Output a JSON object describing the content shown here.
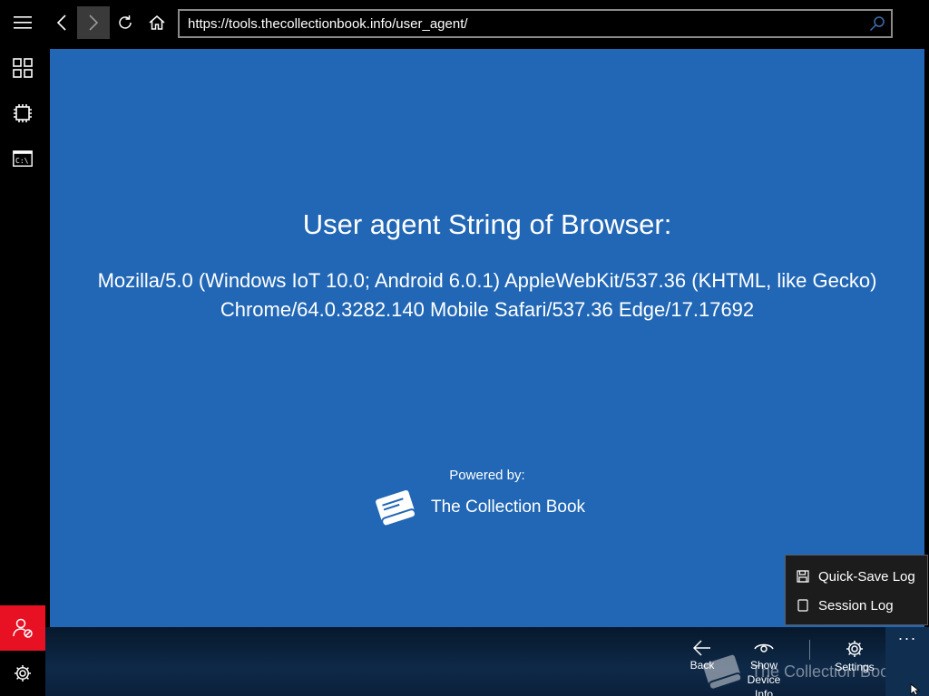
{
  "topbar": {
    "url": "https://tools.thecollectionbook.info/user_agent/"
  },
  "rail": {
    "items": [
      "menu-icon",
      "apps-icon",
      "processor-icon",
      "command-prompt-icon"
    ],
    "bottom": [
      "user-blocked-icon",
      "gear-icon"
    ],
    "alert_color": "#e81123"
  },
  "page": {
    "title": "User agent String of Browser:",
    "ua_line1": "Mozilla/5.0 (Windows IoT 10.0; Android 6.0.1) AppleWebKit/537.36 (KHTML, like Gecko)",
    "ua_line2": "Chrome/64.0.3282.140 Mobile Safari/537.36 Edge/17.17692",
    "powered_by": "Powered by:",
    "brand": "The Collection Book",
    "background": "#2167b5"
  },
  "cmdbar": {
    "back": "Back",
    "show_line1": "Show",
    "show_line2": "Device Info",
    "settings": "Settings",
    "more": "···",
    "watermark": "The Collection Book"
  },
  "menu": {
    "items": [
      {
        "label": "Quick-Save Log",
        "icon": "save-icon"
      },
      {
        "label": "Session Log",
        "icon": "document-icon"
      }
    ]
  }
}
